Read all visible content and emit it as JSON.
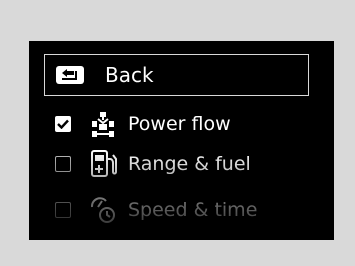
{
  "menu": {
    "back_label": "Back",
    "items": [
      {
        "label": "Power flow",
        "checked": true,
        "icon": "power-flow-icon"
      },
      {
        "label": "Range & fuel",
        "checked": false,
        "icon": "fuel-pump-icon"
      },
      {
        "label": "Speed & time",
        "checked": false,
        "icon": "speed-time-icon"
      }
    ]
  },
  "colors": {
    "background": "#d9d9d9",
    "screen": "#000000",
    "text": "#ffffff",
    "border": "#d8d8d8"
  }
}
